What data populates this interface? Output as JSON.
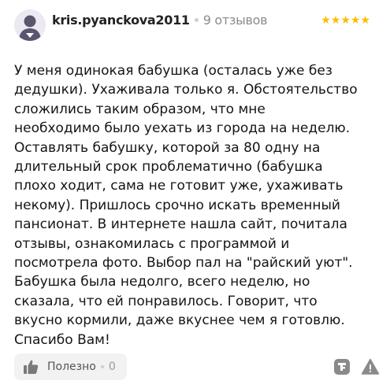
{
  "review": {
    "author": "kris.pyanckova2011",
    "reviews_count": "9 отзывов",
    "rating": 5,
    "stars_text": "★★★★★",
    "text": "У меня одинокая бабушка (осталась уже без\nдедушки). Ухаживала только я. Обстоятельство\nсложились таким образом, что мне\nнеобходимо было уехать из города на неделю.\nОставлять бабушку, которой за 80 одну на\nдлительный срок проблематично (бабушка\nплохо ходит, сама не готовит уже, ухаживать\nнекому). Пришлось срочно искать временный\nпансионат. В интернете нашла сайт, почитала\nотзывы, ознакомилась с программой и\nпосмотрела фото. Выбор пал на \"райский уют\".\nБабушка была недолго, всего неделю, но\nсказала, что ей понравилось. Говорит, что\nвкусно кормили, даже вкуснее чем я готовлю.\nСпасибо Вам!"
  },
  "footer": {
    "like_label": "Полезно",
    "like_count": "0"
  },
  "icons": {
    "avatar": "user-avatar-icon",
    "like": "thumbs-up-icon",
    "share": "share-icon",
    "report": "warning-icon"
  },
  "colors": {
    "stars": "#fbbc05",
    "muted": "#8b8b8b",
    "button_bg": "#f2f2f2"
  }
}
